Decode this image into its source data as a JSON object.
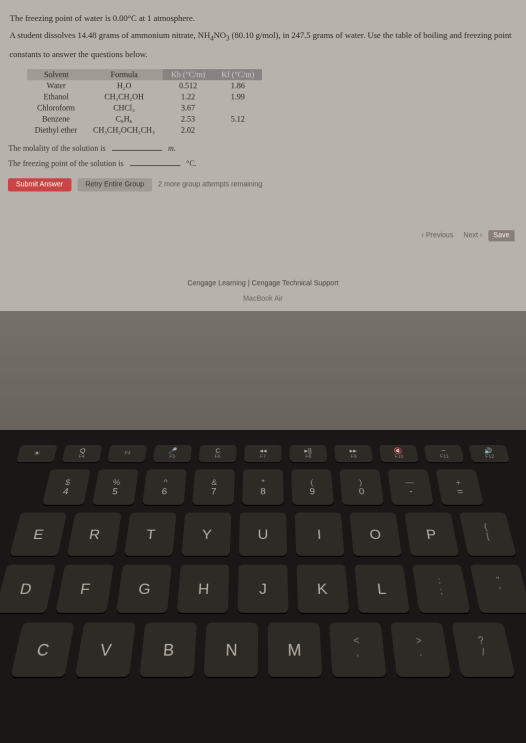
{
  "problem": {
    "line1": "The freezing point of water is 0.00°C at 1 atmosphere.",
    "line2_a": "A student dissolves 14.48 grams of ammonium nitrate, NH",
    "line2_b": "NO",
    "line2_c": " (80.10 g/mol), in 247.5 grams of water. Use the table of boiling and freezing point",
    "line3": "constants to answer the questions below."
  },
  "table": {
    "headers": [
      "Solvent",
      "Formula",
      "Kb (°C/m)",
      "Kf (°C/m)"
    ],
    "rows": [
      [
        "Water",
        "H₂O",
        "0.512",
        "1.86"
      ],
      [
        "Ethanol",
        "CH₃CH₂OH",
        "1.22",
        "1.99"
      ],
      [
        "Chloroform",
        "CHCl₃",
        "3.67",
        ""
      ],
      [
        "Benzene",
        "C₆H₆",
        "2.53",
        "5.12"
      ],
      [
        "Diethyl ether",
        "CH₃CH₂OCH₂CH₃",
        "2.02",
        ""
      ]
    ]
  },
  "questions": {
    "q1": "The molality of the solution is",
    "q1_unit": "m.",
    "q2": "The freezing point of the solution is",
    "q2_unit": "°C."
  },
  "buttons": {
    "submit": "Submit Answer",
    "retry": "Retry Entire Group",
    "attempts": "2 more group attempts remaining"
  },
  "nav": {
    "previous": "Previous",
    "next": "Next",
    "save": "Save"
  },
  "footer": {
    "support": "Cengage Learning | Cengage Technical Support",
    "device": "MacBook Air"
  },
  "keyboard": {
    "fn_row": [
      {
        "main": "☀",
        "sub": ""
      },
      {
        "main": "Q",
        "sub": "F4"
      },
      {
        "main": "",
        "sub": "F4"
      },
      {
        "main": "🎤",
        "sub": "F5"
      },
      {
        "main": "C",
        "sub": "F6"
      },
      {
        "main": "◂◂",
        "sub": "F7"
      },
      {
        "main": "▸||",
        "sub": "F8"
      },
      {
        "main": "▸▸",
        "sub": "F9"
      },
      {
        "main": "🔇",
        "sub": "F10"
      },
      {
        "main": "−",
        "sub": "F11"
      },
      {
        "main": "🔊",
        "sub": "F12"
      }
    ],
    "num_row": [
      {
        "top": "$",
        "main": "4"
      },
      {
        "top": "%",
        "main": "5"
      },
      {
        "top": "^",
        "main": "6"
      },
      {
        "top": "&",
        "main": "7"
      },
      {
        "top": "*",
        "main": "8"
      },
      {
        "top": "(",
        "main": "9"
      },
      {
        "top": ")",
        "main": "0"
      },
      {
        "top": "—",
        "main": "-"
      },
      {
        "top": "+",
        "main": "="
      }
    ],
    "row_q": [
      "E",
      "R",
      "T",
      "Y",
      "U",
      "I",
      "O",
      "P"
    ],
    "row_q_side": [
      {
        "top": "{",
        "bot": "["
      }
    ],
    "row_a": [
      "D",
      "F",
      "G",
      "H",
      "J",
      "K",
      "L"
    ],
    "row_a_side": [
      {
        "top": ":",
        "bot": ";"
      },
      {
        "top": "\"",
        "bot": "'"
      }
    ],
    "row_z": [
      "C",
      "V",
      "B",
      "N",
      "M"
    ],
    "row_z_side": [
      {
        "top": "<",
        "bot": ","
      },
      {
        "top": ">",
        "bot": "."
      },
      {
        "top": "?",
        "bot": "/"
      }
    ]
  }
}
